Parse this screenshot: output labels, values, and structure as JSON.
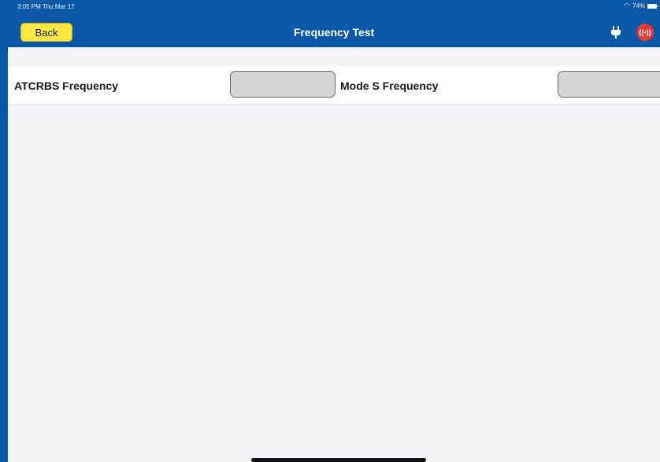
{
  "status_bar": {
    "time": "3:05 PM  Thu Mar 17",
    "battery": "74%"
  },
  "header": {
    "back_label": "Back",
    "title": "Frequency Test",
    "signal_glyph": "((•))",
    "icons": [
      "plug-icon",
      "signal-icon"
    ]
  },
  "fields": {
    "atcrbs": {
      "label": "ATCRBS Frequency",
      "value": ""
    },
    "mode_s": {
      "label": "Mode S Frequency",
      "value": ""
    }
  },
  "colors": {
    "header": "#0a58a8",
    "back_button": "#fde843",
    "signal": "#e53935",
    "background": "#f2f2f6"
  }
}
